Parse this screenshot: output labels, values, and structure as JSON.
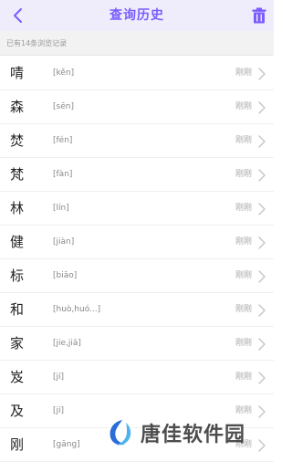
{
  "header": {
    "title": "查询历史",
    "back_icon": "chevron-left-icon",
    "delete_icon": "trash-icon",
    "accent_color": "#7a5cff"
  },
  "summary": {
    "text": "已有14条浏览记录"
  },
  "history": [
    {
      "char": "啨",
      "pinyin": "[kěn]",
      "time": "刚刚"
    },
    {
      "char": "森",
      "pinyin": "[sēn]",
      "time": "刚刚"
    },
    {
      "char": "焚",
      "pinyin": "[fén]",
      "time": "刚刚"
    },
    {
      "char": "梵",
      "pinyin": "[fàn]",
      "time": "刚刚"
    },
    {
      "char": "林",
      "pinyin": "[lín]",
      "time": "刚刚"
    },
    {
      "char": "健",
      "pinyin": "[jiàn]",
      "time": "刚刚"
    },
    {
      "char": "标",
      "pinyin": "[biāo]",
      "time": "刚刚"
    },
    {
      "char": "和",
      "pinyin": "[huò,huó...]",
      "time": "刚刚"
    },
    {
      "char": "家",
      "pinyin": "[jie,jiā]",
      "time": "刚刚"
    },
    {
      "char": "岌",
      "pinyin": "[jí]",
      "time": "刚刚"
    },
    {
      "char": "及",
      "pinyin": "[jí]",
      "time": "刚刚"
    },
    {
      "char": "刚",
      "pinyin": "[gāng]",
      "time": "刚刚"
    }
  ],
  "watermark": {
    "text": "唐佳软件园"
  }
}
